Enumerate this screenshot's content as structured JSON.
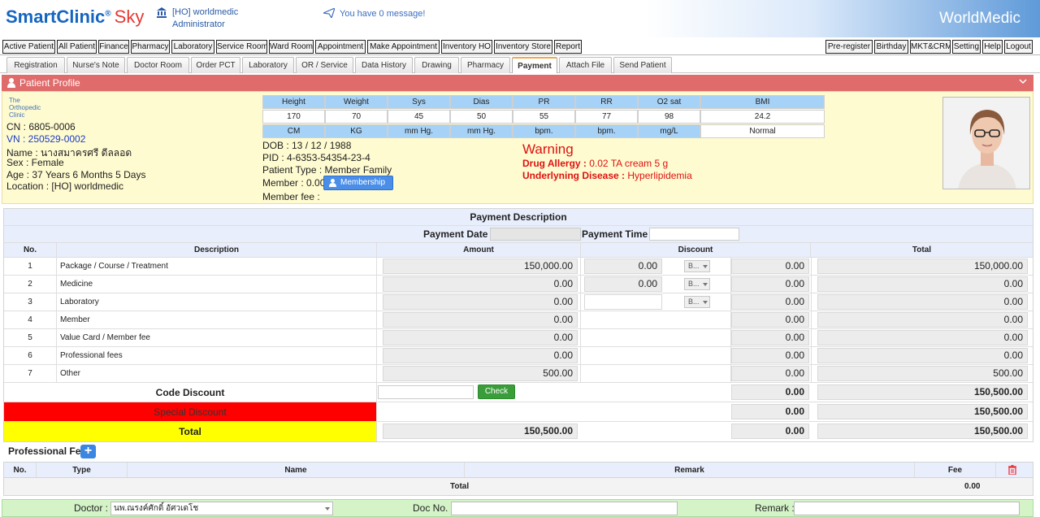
{
  "header": {
    "logo_text": "SmartClinic",
    "logo_reg": "®",
    "logo_sky": "Sky",
    "branch": "[HO] worldmedic",
    "user": "Administrator",
    "message": "You have 0 message!",
    "brand": "WorldMedic"
  },
  "menu_left": [
    "Active Patient",
    "All Patient",
    "Finance",
    "Pharmacy",
    "Laboratory",
    "Service Room",
    "Ward Room",
    "Appointment",
    "Make Appointment",
    "Inventory HO",
    "Inventory Store",
    "Report"
  ],
  "menu_right": [
    "Pre-register",
    "Birthday",
    "MKT&CRM",
    "Setting",
    "Help",
    "Logout"
  ],
  "tabs": [
    "Registration",
    "Nurse's Note",
    "Doctor Room",
    "Order PCT",
    "Laboratory",
    "OR / Service",
    "Data History",
    "Drawing",
    "Pharmacy",
    "Payment",
    "Attach File",
    "Send Patient"
  ],
  "patient": {
    "title": "Patient Profile",
    "clinic": [
      "The",
      "Orthopedic",
      "Clinic"
    ],
    "cn": "CN : 6805-0006",
    "vn": "VN : 250529-0002",
    "name": "Name : นางสมาครศรี ดีลลอด",
    "sex": "Sex : Female",
    "age": "Age : 37 Years 6 Months 5 Days",
    "location": "Location : [HO] worldmedic",
    "vitals_head": [
      "Height",
      "Weight",
      "Sys",
      "Dias",
      "PR",
      "RR",
      "O2 sat",
      "BMI"
    ],
    "vitals_val": [
      "170",
      "70",
      "45",
      "50",
      "55",
      "77",
      "98",
      "24.2"
    ],
    "vitals_unit": [
      "CM",
      "KG",
      "mm Hg.",
      "mm Hg.",
      "bpm.",
      "bpm.",
      "mg/L",
      "Normal"
    ],
    "dob": "DOB : 13 / 12 / 1988",
    "pid": "PID : 4-6353-54354-23-4",
    "ptype": "Patient Type : Member Family",
    "member": "Member : 0.00",
    "membership_btn": "Membership",
    "member_fee": "Member fee :",
    "warning": "Warning",
    "allergy_label": "Drug Allergy :",
    "allergy": "0.02 TA cream 5 g",
    "disease_label": "Underlyning Disease :",
    "disease": "Hyperlipidemia"
  },
  "payment": {
    "title": "Payment Description",
    "date_label": "Payment Date :",
    "time_label": "Payment Time :",
    "col_no": "No.",
    "col_desc": "Description",
    "col_amount": "Amount",
    "col_discount": "Discount",
    "col_total": "Total",
    "rows": [
      {
        "no": "1",
        "desc": "Package / Course / Treatment",
        "amount": "150,000.00",
        "disc": "0.00",
        "sel": "B...",
        "dtotal": "0.00",
        "total": "150,000.00"
      },
      {
        "no": "2",
        "desc": "Medicine",
        "amount": "0.00",
        "disc": "0.00",
        "sel": "B...",
        "dtotal": "0.00",
        "total": "0.00"
      },
      {
        "no": "3",
        "desc": "Laboratory",
        "amount": "0.00",
        "disc": "",
        "sel": "B...",
        "dtotal": "0.00",
        "total": "0.00"
      },
      {
        "no": "4",
        "desc": "Member",
        "amount": "0.00",
        "dtotal": "0.00",
        "total": "0.00"
      },
      {
        "no": "5",
        "desc": "Value Card / Member fee",
        "amount": "0.00",
        "dtotal": "0.00",
        "total": "0.00"
      },
      {
        "no": "6",
        "desc": "Professional fees",
        "amount": "0.00",
        "dtotal": "0.00",
        "total": "0.00"
      },
      {
        "no": "7",
        "desc": "Other",
        "amount": "500.00",
        "dtotal": "0.00",
        "total": "500.00"
      }
    ],
    "code_discount": "Code Discount",
    "check_btn": "Check",
    "code_dtotal": "0.00",
    "code_total": "150,500.00",
    "special_discount": "Special Discount",
    "special_dtotal": "0.00",
    "special_total": "150,500.00",
    "total_label": "Total",
    "total_amount": "150,500.00",
    "total_disc": "0.00",
    "total_total": "150,500.00"
  },
  "prof_fee": {
    "title": "Professional Fee",
    "add": "+",
    "cols": [
      "No.",
      "Type",
      "Name",
      "Remark",
      "Fee"
    ],
    "total_label": "Total",
    "total": "0.00"
  },
  "footer": {
    "doctor_label": "Doctor :",
    "doctor": "นพ.ณรงค์ศักดิ์ อัศวเดโช",
    "docno_label": "Doc No. :",
    "remark_label": "Remark :"
  }
}
